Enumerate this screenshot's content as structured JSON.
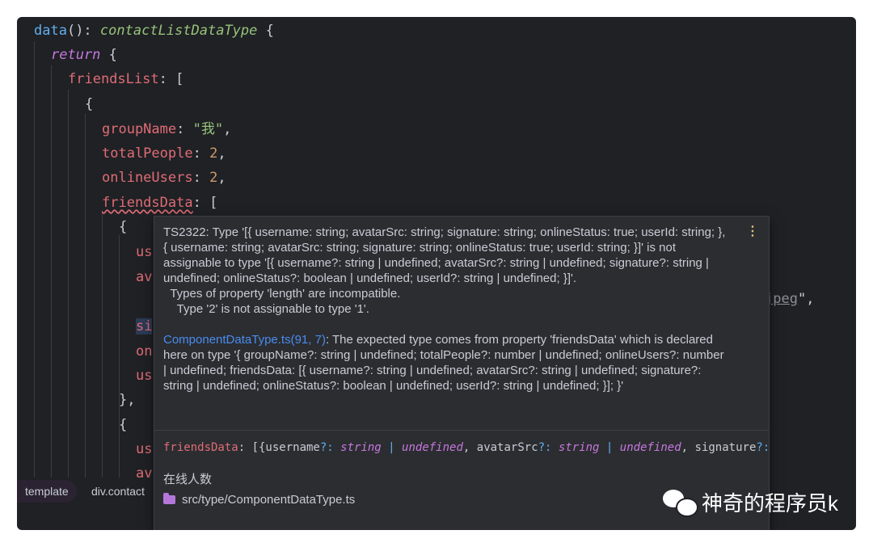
{
  "code": {
    "l1": {
      "fn": "data",
      "paren": "():",
      "type": "contactListDataType",
      "brace": " {"
    },
    "l2": {
      "kw": "return",
      "brace": " {"
    },
    "l3": {
      "prop": "friendsList",
      "rest": ": ["
    },
    "l4": {
      "text": "{"
    },
    "l5": {
      "prop": "groupName",
      "colon": ": ",
      "str": "\"我\"",
      "comma": ","
    },
    "l6": {
      "prop": "totalPeople",
      "colon": ": ",
      "num": "2",
      "comma": ","
    },
    "l7": {
      "prop": "onlineUsers",
      "colon": ": ",
      "num": "2",
      "comma": ","
    },
    "l8": {
      "prop": "friendsData",
      "rest": ": ["
    },
    "l9": {
      "text": "{"
    },
    "l10": {
      "prop": "us"
    },
    "l11": {
      "prop": "av"
    },
    "l13": {
      "prop": "si"
    },
    "l14": {
      "prop": "on"
    },
    "l15": {
      "prop": "us"
    },
    "l16": {
      "text": "},"
    },
    "l17": {
      "text": "{"
    },
    "l18": {
      "prop": "us"
    },
    "l19": {
      "prop": "av"
    },
    "url_tail": {
      "underlined": "jpeg",
      "rest": "\","
    }
  },
  "breadcrumb": {
    "template": "template",
    "div": "div.contact"
  },
  "popup": {
    "error": "TS2322: Type '[{ username: string; avatarSrc: string; signature: string; onlineStatus: true; userId: string; }, { username: string; avatarSrc: string; signature: string; onlineStatus: true; userId: string; }]' is not assignable to type '[{ username?: string | undefined; avatarSrc?: string | undefined; signature?: string | undefined; onlineStatus?: boolean | undefined; userId?: string | undefined; }]'.\n  Types of property 'length' are incompatible.\n    Type '2' is not assignable to type '1'.",
    "link": "ComponentDataType.ts(91, 7)",
    "related": ": The expected type comes from property 'friendsData' which is declared here on type '{ groupName?: string | undefined; totalPeople?: number | undefined; onlineUsers?: number | undefined; friendsData: [{ username?: string | undefined; avatarSrc?: string | undefined; signature?: string | undefined; onlineStatus?: boolean | undefined; userId?: string | undefined; }]; }'",
    "sig": {
      "name": "friendsData",
      "p1": ": [{username",
      "q1": "?:",
      "t1": " string",
      "bar1": " |",
      "u1": " undefined",
      "p2": ", avatarSrc",
      "q2": "?:",
      "t2": " string",
      "bar2": " |",
      "u2": " undefined",
      "p3": ", signature",
      "q3": "?:"
    },
    "description": "在线人数",
    "file": "src/type/ComponentDataType.ts",
    "menu_icon": "more-vertical-icon"
  },
  "watermark": {
    "text": "神奇的程序员k",
    "icon": "wechat-icon"
  },
  "colors": {
    "background": "#1f2125",
    "popup": "#2b2d31",
    "link": "#4a8cf0",
    "property": "#e06c75",
    "string": "#98c379"
  }
}
